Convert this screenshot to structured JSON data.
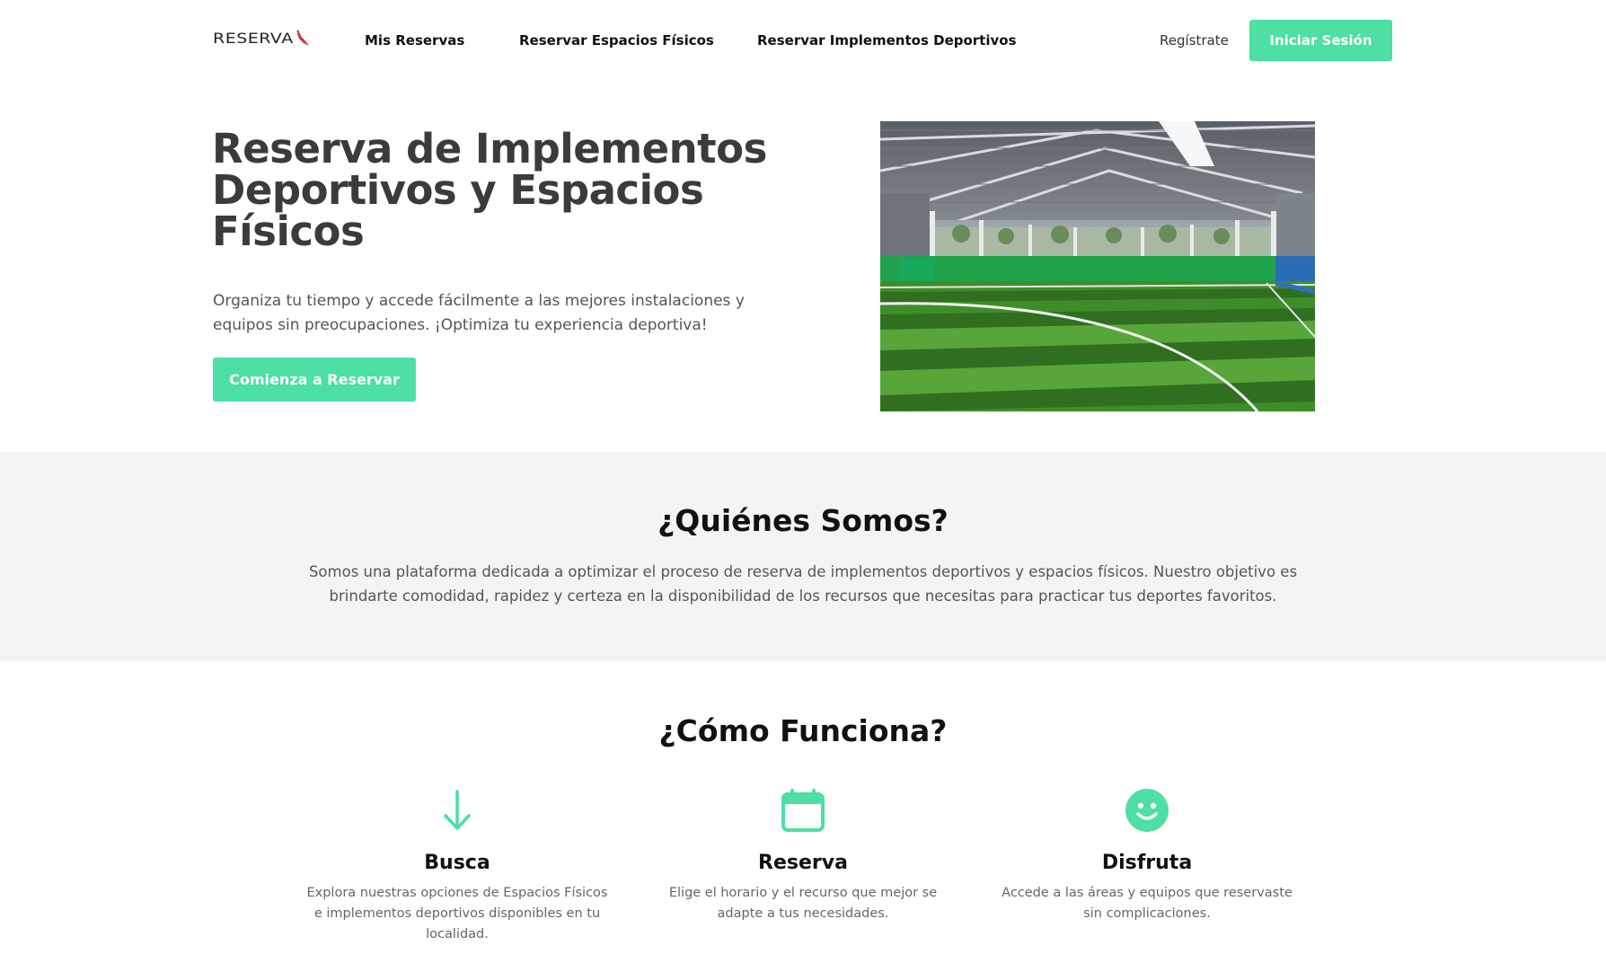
{
  "brand": {
    "logo_text": "Reserva",
    "accent_color": "#4ddfa3",
    "logo_mark_color": "#d6303f"
  },
  "nav": {
    "links": [
      "Mis Reservas",
      "Reservar Espacios Físicos",
      "Reservar Implementos Deportivos"
    ],
    "register_label": "Regístrate",
    "login_label": "Iniciar Sesión"
  },
  "hero": {
    "title": "Reserva de Implementos Deportivos y Espacios Físicos",
    "description": "Organiza tu tiempo y accede fácilmente a las mejores instalaciones y equipos sin preocupaciones. ¡Optimiza tu experiencia deportiva!",
    "cta_label": "Comienza a Reservar"
  },
  "about": {
    "title": "¿Quiénes Somos?",
    "text": "Somos una plataforma dedicada a optimizar el proceso de reserva de implementos deportivos y espacios físicos. Nuestro objetivo es brindarte comodidad, rapidez y certeza en la disponibilidad de los recursos que necesitas para practicar tus deportes favoritos."
  },
  "how": {
    "title": "¿Cómo Funciona?",
    "steps": [
      {
        "icon": "arrow-down-icon",
        "title": "Busca",
        "description": "Explora nuestras opciones de Espacios Físicos e implementos deportivos disponibles en tu localidad."
      },
      {
        "icon": "calendar-icon",
        "title": "Reserva",
        "description": "Elige el horario y el recurso que mejor se adapte a tus necesidades."
      },
      {
        "icon": "smiley-icon",
        "title": "Disfruta",
        "description": "Accede a las áreas y equipos que reservaste sin complicaciones."
      }
    ]
  }
}
